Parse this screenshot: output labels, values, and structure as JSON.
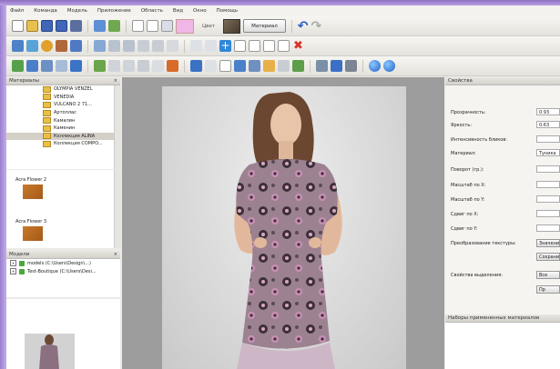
{
  "menu": [
    "Файл",
    "Команда",
    "Модель",
    "Приложение",
    "Область",
    "Вид",
    "Окно",
    "Помощь"
  ],
  "toolbar": {
    "color_label": "Цвет",
    "material_button": "Материал",
    "swatch_color": "#f0b6e6"
  },
  "materials_panel": {
    "title": "Материалы",
    "close": "×",
    "folders": [
      "OLYMPIA VENZEL",
      "VENEDIA",
      "VULCANO 2 71...",
      "Артоплас",
      "Камалин",
      "Каменин",
      "Коллекция ALINA",
      "Коллекция COMPO..."
    ],
    "selected_index": 6,
    "thumbnails": [
      {
        "title": "Acra Flower 2"
      },
      {
        "title": "Acra Flower 3"
      }
    ]
  },
  "models_panel": {
    "title": "Модели",
    "close": "×",
    "items": [
      "models (C:\\Users\\Design\\...)",
      "Test-Boutique (C:\\Users\\Desi..."
    ]
  },
  "properties_panel": {
    "title": "Свойства",
    "rows": [
      {
        "label": "Прозрачность:",
        "value": "0.93"
      },
      {
        "label": "Яркость:",
        "value": "0.63"
      },
      {
        "label": "Интенсивность бликов:",
        "value": ""
      },
      {
        "label": "Материал:",
        "value": "Туника"
      },
      {
        "label": "Поворот (гр.):",
        "value": ""
      },
      {
        "label": "Масштаб по X:",
        "value": ""
      },
      {
        "label": "Масштаб по Y:",
        "value": ""
      },
      {
        "label": "Сдвиг по X:",
        "value": ""
      },
      {
        "label": "Сдвиг по Y:",
        "value": ""
      }
    ],
    "texture_label": "Преобразование текстуры:",
    "texture_button": "Значение",
    "save_button": "Сохранить",
    "selection_label": "Свойства выделения:",
    "selection_button": "Все",
    "extra_button": "Пр"
  },
  "applied_panel": {
    "title": "Наборы примененных материалов"
  }
}
